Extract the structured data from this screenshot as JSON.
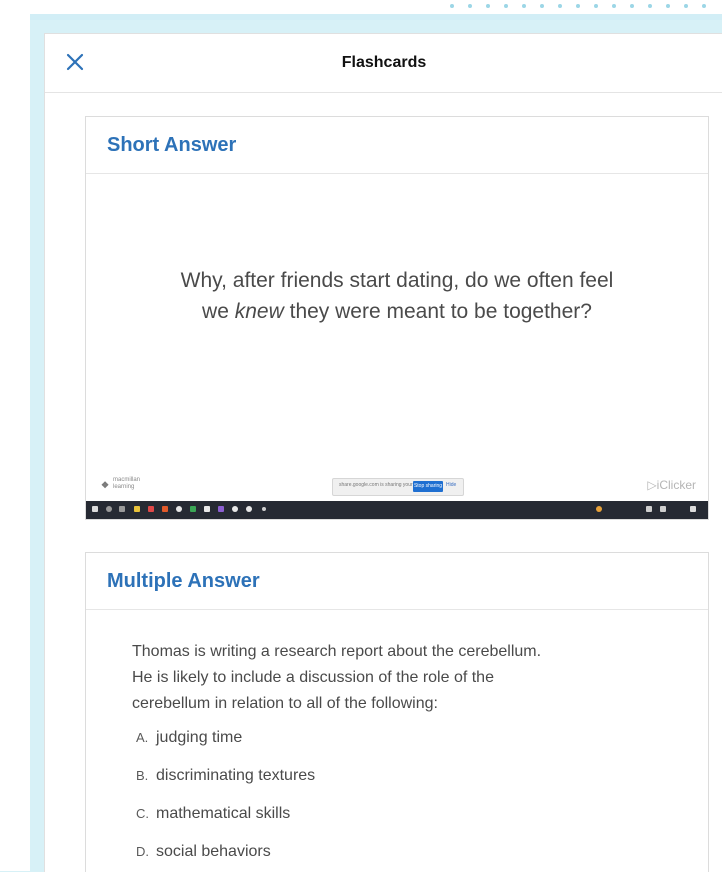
{
  "header": {
    "title": "Flashcards"
  },
  "cards": [
    {
      "type_label": "Short Answer",
      "question_lines": [
        "Why, after friends start dating, do we often feel",
        "we",
        "knew",
        "they were meant to be together?"
      ],
      "slide_footer": {
        "logo_text": "macmillan learning",
        "share_notice": "share.google.com is sharing your screen",
        "stop_sharing_label": "Stop sharing",
        "hide_label": "Hide",
        "brand": "iClicker"
      }
    },
    {
      "type_label": "Multiple Answer",
      "question_lines": [
        "Thomas is writing a research report about the cerebellum.",
        "He is likely to include a discussion of the role of the",
        "cerebellum in relation to all of the following:"
      ],
      "options": [
        {
          "letter": "A.",
          "text": "judging time"
        },
        {
          "letter": "B.",
          "text": "discriminating textures"
        },
        {
          "letter": "C.",
          "text": "mathematical skills"
        },
        {
          "letter": "D.",
          "text": "social behaviors"
        }
      ]
    }
  ],
  "colors": {
    "accent": "#2d72b8",
    "background": "#d7f1f7",
    "taskbar": "#262a33"
  },
  "icons": {
    "close": "close-icon"
  }
}
